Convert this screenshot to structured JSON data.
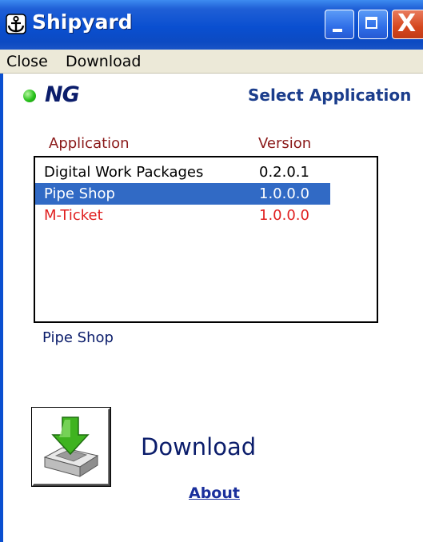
{
  "window": {
    "title": "Shipyard",
    "icon": "anchor-icon",
    "controls": [
      "minimize-icon",
      "maximize-icon",
      "close-icon"
    ],
    "close_glyph": "X"
  },
  "menu": {
    "items": [
      {
        "label": "Close"
      },
      {
        "label": "Download"
      }
    ]
  },
  "header": {
    "status": "green",
    "brand": "NG",
    "title": "Select Application"
  },
  "list": {
    "columns": [
      "Application",
      "Version"
    ],
    "rows": [
      {
        "application": "Digital Work Packages",
        "version": "0.2.0.1",
        "style": "normal"
      },
      {
        "application": "Pipe Shop",
        "version": "1.0.0.0",
        "style": "selected"
      },
      {
        "application": "M-Ticket",
        "version": "1.0.0.0",
        "style": "red"
      }
    ]
  },
  "selected_application": "Pipe Shop",
  "actions": {
    "download_icon": "download-tray-icon",
    "download_label": "Download",
    "about_label": "About"
  },
  "colors": {
    "titlebar": "#0a4fd0",
    "selection": "#316ac5",
    "column_header": "#8b1a1a",
    "error_row": "#e01f1f",
    "brand": "#0b1d6b"
  }
}
